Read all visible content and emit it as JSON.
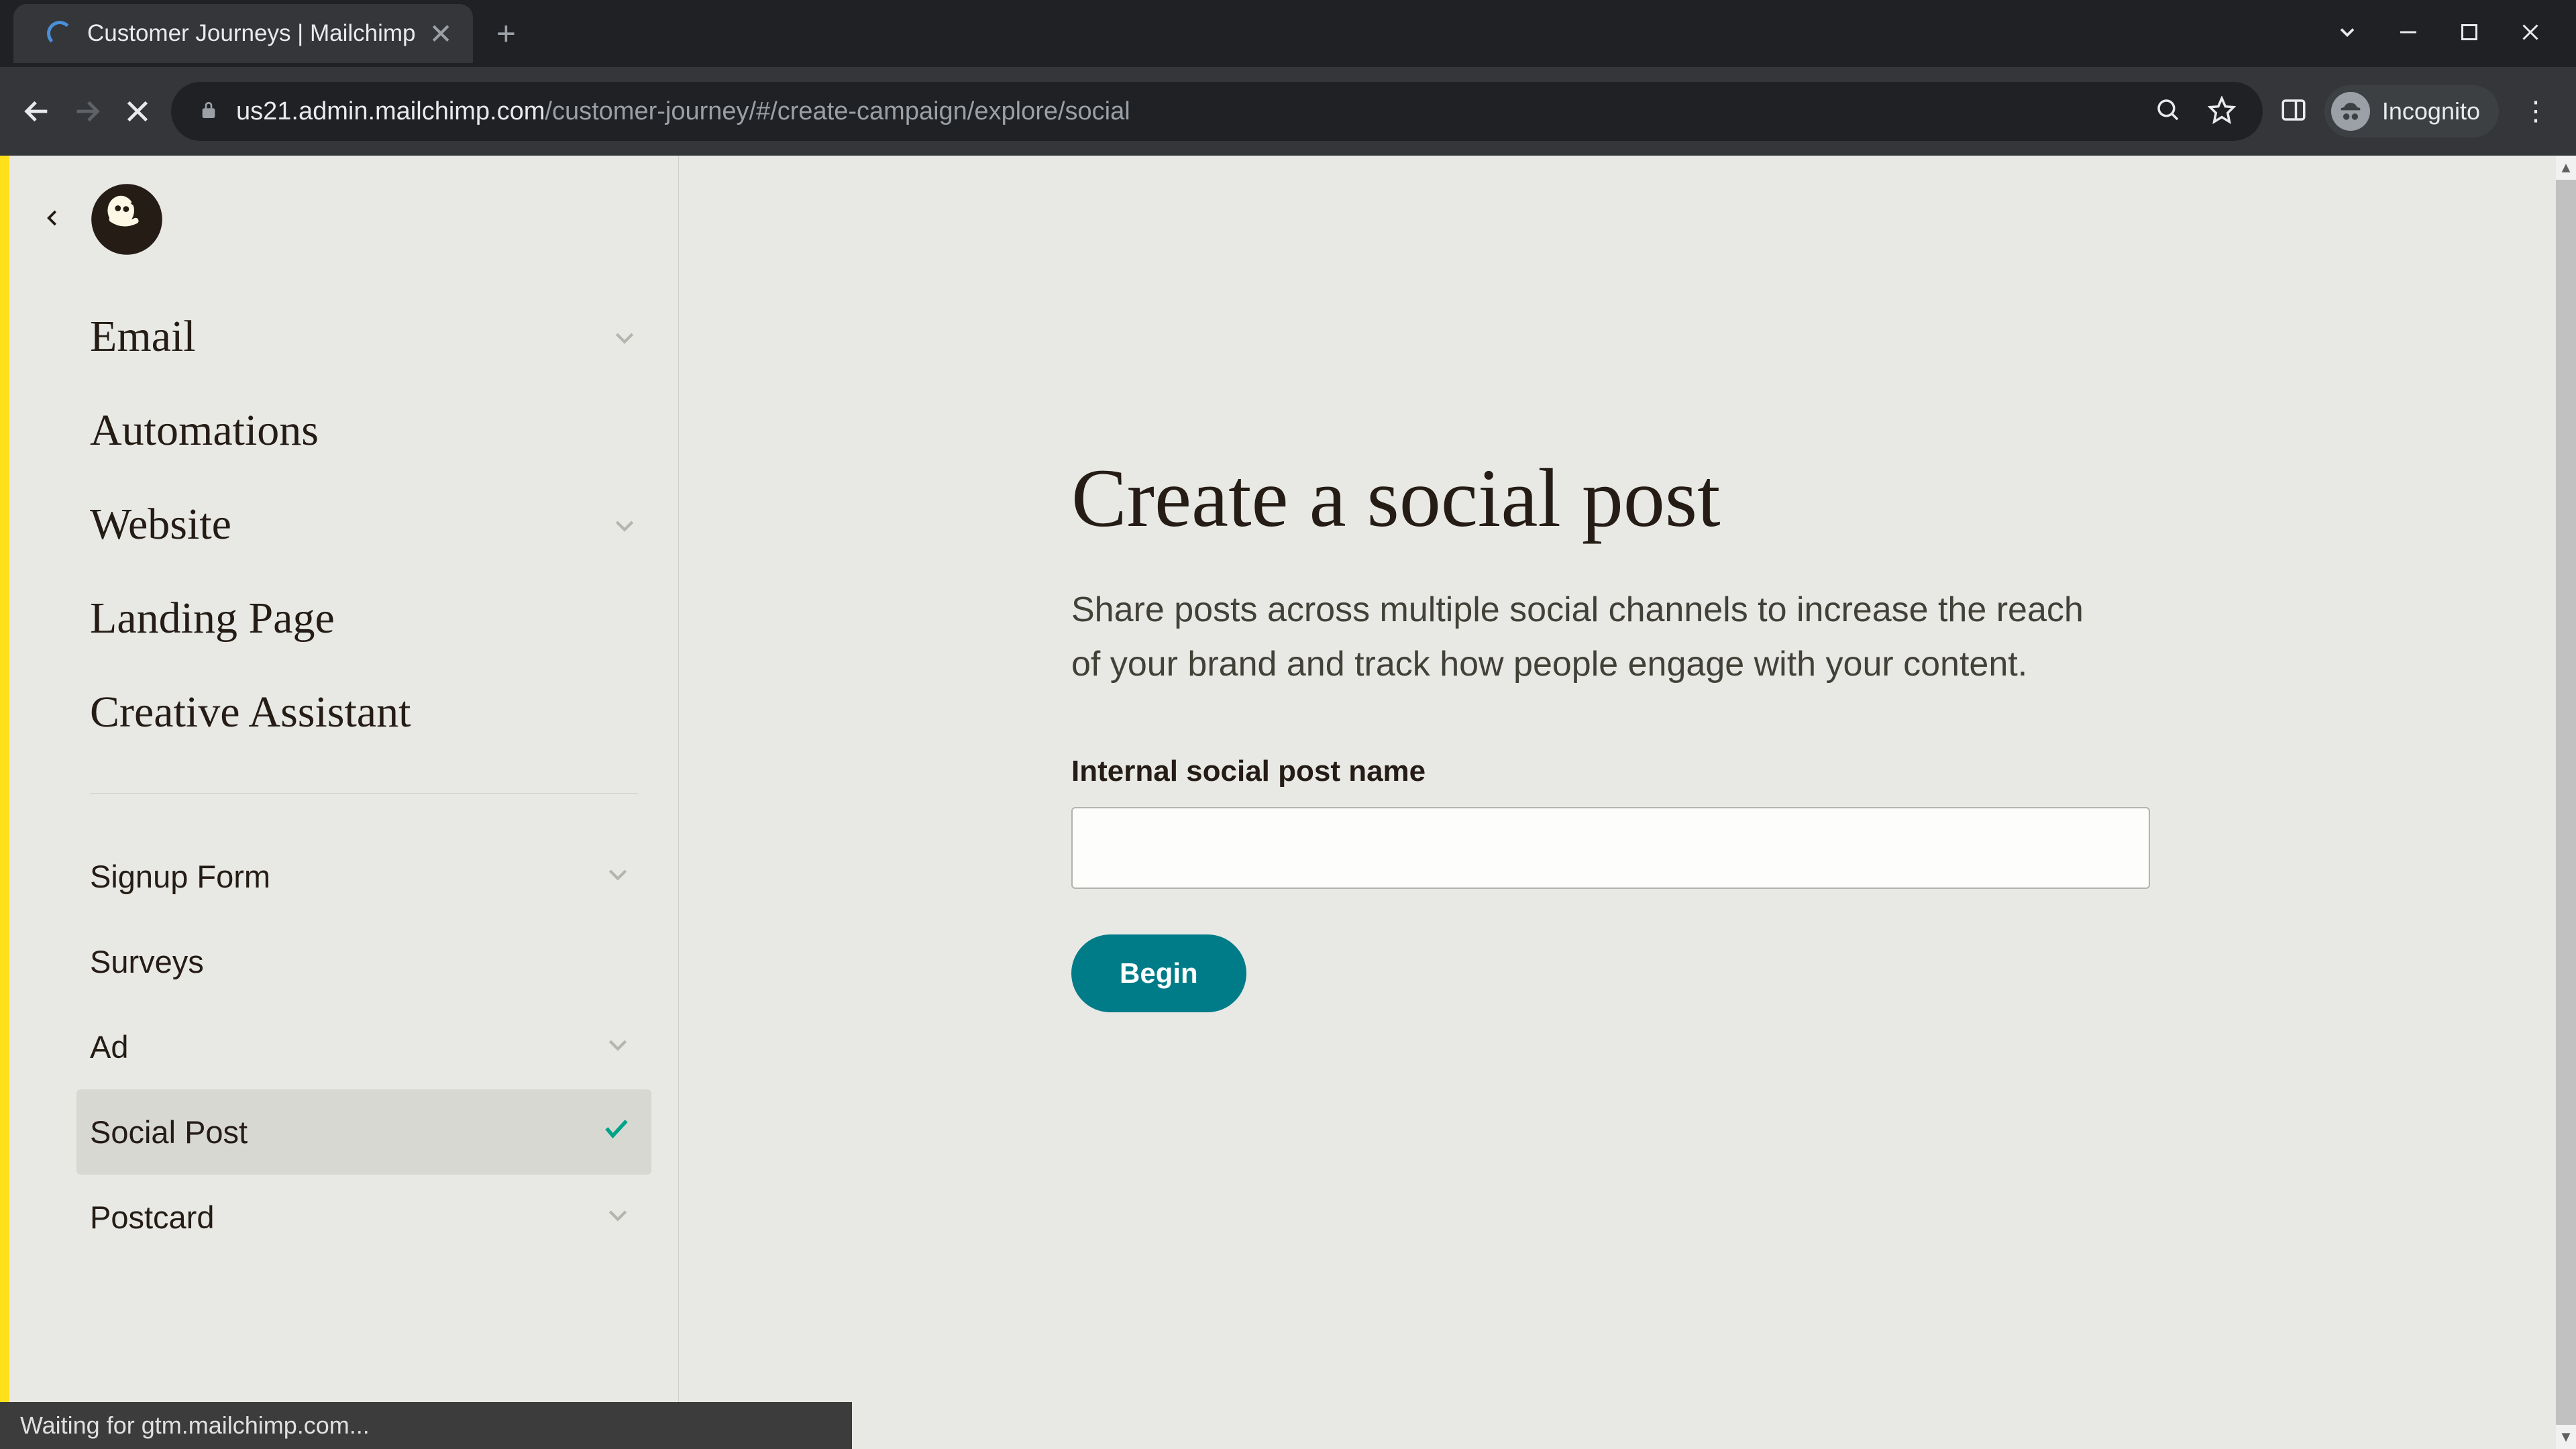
{
  "browser": {
    "tab_title": "Customer Journeys | Mailchimp",
    "url_host": "us21.admin.mailchimp.com",
    "url_path": "/customer-journey/#/create-campaign/explore/social",
    "incognito_label": "Incognito",
    "status_text": "Waiting for gtm.mailchimp.com..."
  },
  "sidebar": {
    "primary": [
      {
        "label": "Email",
        "expandable": true
      },
      {
        "label": "Automations",
        "expandable": false
      },
      {
        "label": "Website",
        "expandable": true
      },
      {
        "label": "Landing Page",
        "expandable": false
      },
      {
        "label": "Creative Assistant",
        "expandable": false
      }
    ],
    "secondary": [
      {
        "label": "Signup Form",
        "expandable": true,
        "active": false
      },
      {
        "label": "Surveys",
        "expandable": false,
        "active": false
      },
      {
        "label": "Ad",
        "expandable": true,
        "active": false
      },
      {
        "label": "Social Post",
        "expandable": false,
        "active": true
      },
      {
        "label": "Postcard",
        "expandable": true,
        "active": false
      }
    ]
  },
  "main": {
    "title": "Create a social post",
    "description": "Share posts across multiple social channels to increase the reach of your brand and track how people engage with your content.",
    "field_label": "Internal social post name",
    "input_value": "",
    "begin_label": "Begin"
  }
}
